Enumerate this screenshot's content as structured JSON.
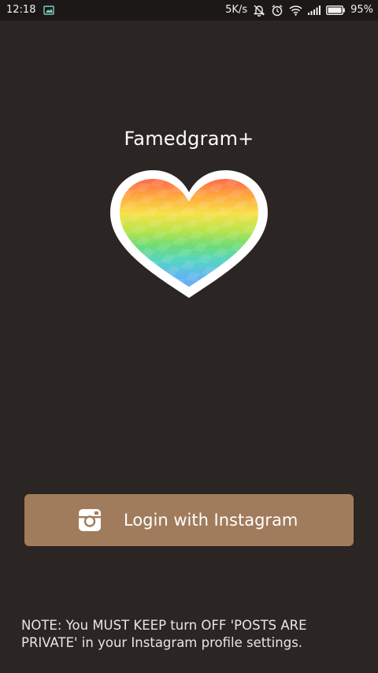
{
  "status_bar": {
    "time": "12:18",
    "speed": "5K/s",
    "battery": "95%",
    "icons": [
      "screenshot-icon",
      "bell-off-icon",
      "alarm-clock-icon",
      "wifi-icon",
      "signal-icon",
      "battery-icon"
    ]
  },
  "app": {
    "title": "Famedgram+",
    "logo": "rainbow-heart-icon"
  },
  "login": {
    "label": "Login with Instagram",
    "icon": "instagram-icon",
    "color": "#a07c5c"
  },
  "note": {
    "text": "NOTE: You MUST KEEP turn OFF 'POSTS ARE PRIVATE' in your Instagram profile settings."
  },
  "colors": {
    "background": "#2b2523",
    "status_bar": "#1c1817",
    "text": "#ffffff"
  }
}
